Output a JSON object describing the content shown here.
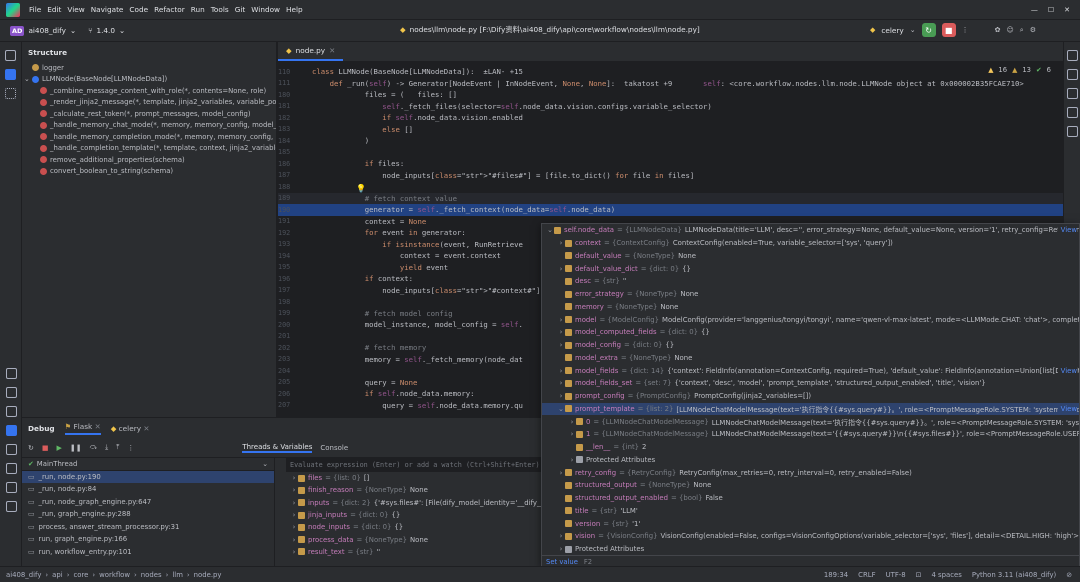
{
  "menu": [
    "File",
    "Edit",
    "View",
    "Navigate",
    "Code",
    "Refactor",
    "Run",
    "Tools",
    "Git",
    "Window",
    "Help"
  ],
  "project": {
    "badge": "AD",
    "name": "ai408_dify",
    "version": "1.4.0"
  },
  "path_title": "nodes\\llm\\node.py [F:\\Dify资料\\ai408_dify\\api\\core\\workflow\\nodes\\llm\\node.py]",
  "run_config": "celery",
  "structure": {
    "title": "Structure",
    "items": [
      {
        "text": "logger",
        "color": "#c59a4a"
      },
      {
        "text": "LLMNode(BaseNode[LLMNodeData])",
        "color": "#3574f0"
      },
      {
        "text": "_combine_message_content_with_role(*, contents=None, role)",
        "color": "#c94f4f"
      },
      {
        "text": "_render_jinja2_message(*, template, jinja2_variables, variable_pool)",
        "color": "#c94f4f"
      },
      {
        "text": "_calculate_rest_token(*, prompt_messages, model_config)",
        "color": "#c94f4f"
      },
      {
        "text": "_handle_memory_chat_mode(*, memory, memory_config, model_config)",
        "color": "#c94f4f"
      },
      {
        "text": "_handle_memory_completion_mode(*, memory, memory_config, model_config)",
        "color": "#c94f4f"
      },
      {
        "text": "_handle_completion_template(*, template, context, jinja2_variables, variable_pool)",
        "color": "#c94f4f"
      },
      {
        "text": "remove_additional_properties(schema)",
        "color": "#c94f4f"
      },
      {
        "text": "convert_boolean_to_string(schema)",
        "color": "#c94f4f"
      }
    ]
  },
  "editor_tab": "node.py",
  "code_lines": [
    {
      "n": "110",
      "t": "class LLMNode(BaseNode[LLMNodeData]):  ±LAN- +15"
    },
    {
      "n": "111",
      "t": "    def _run(self) -> Generator[NodeEvent | InNodeEvent, None, None]:  takatost +9       self: <core.workflow.nodes.llm.node.LLMNode object at 0x000002B35FCAE710>"
    },
    {
      "n": "180",
      "t": "            files = (   files: []"
    },
    {
      "n": "181",
      "t": "                self._fetch_files(selector=self.node_data.vision.configs.variable_selector)"
    },
    {
      "n": "182",
      "t": "                if self.node_data.vision.enabled"
    },
    {
      "n": "183",
      "t": "                else []"
    },
    {
      "n": "184",
      "t": "            )"
    },
    {
      "n": "185",
      "t": ""
    },
    {
      "n": "186",
      "t": "            if files:"
    },
    {
      "n": "187",
      "t": "                node_inputs[\"#files#\"] = [file.to_dict() for file in files]"
    },
    {
      "n": "188",
      "t": ""
    },
    {
      "n": "189",
      "t": "            # fetch context value"
    },
    {
      "n": "190",
      "t": "            generator = self._fetch_context(node_data=self.node_data)"
    },
    {
      "n": "191",
      "t": "            context = None"
    },
    {
      "n": "192",
      "t": "            for event in generator:"
    },
    {
      "n": "193",
      "t": "                if isinstance(event, RunRetrieve"
    },
    {
      "n": "194",
      "t": "                    context = event.context"
    },
    {
      "n": "195",
      "t": "                    yield event"
    },
    {
      "n": "196",
      "t": "            if context:"
    },
    {
      "n": "197",
      "t": "                node_inputs[\"#context#\"] = conte"
    },
    {
      "n": "198",
      "t": ""
    },
    {
      "n": "199",
      "t": "            # fetch model config"
    },
    {
      "n": "200",
      "t": "            model_instance, model_config = self."
    },
    {
      "n": "201",
      "t": ""
    },
    {
      "n": "202",
      "t": "            # fetch memory"
    },
    {
      "n": "203",
      "t": "            memory = self._fetch_memory(node_dat"
    },
    {
      "n": "204",
      "t": ""
    },
    {
      "n": "205",
      "t": "            query = None"
    },
    {
      "n": "206",
      "t": "            if self.node_data.memory:"
    },
    {
      "n": "207",
      "t": "                query = self.node_data.memory.qu"
    }
  ],
  "inspections": {
    "warnings": "16",
    "weak": "13",
    "ok": "6"
  },
  "debug": {
    "title": "Debug",
    "tabs": [
      "Flask",
      "celery"
    ],
    "subtabs": [
      "Threads & Variables",
      "Console"
    ],
    "thread": "MainThread",
    "eval_placeholder": "Evaluate expression (Enter) or add a watch (Ctrl+Shift+Enter)",
    "frames": [
      "_run, node.py:190",
      "_run, node.py:84",
      "_run, node_graph_engine.py:647",
      "_run, graph_engine.py:288",
      "process, answer_stream_processor.py:31",
      "run, graph_engine.py:166",
      "run, workflow_entry.py:101"
    ],
    "vars": [
      {
        "name": "files",
        "type": "{list: 0}",
        "val": "[]"
      },
      {
        "name": "finish_reason",
        "type": "{NoneType}",
        "val": "None"
      },
      {
        "name": "inputs",
        "type": "{dict: 2}",
        "val": "{'#sys.files#': [File(dify_model_identity='__dify__file__', id=("
      },
      {
        "name": "jinja_inputs",
        "type": "{dict: 0}",
        "val": "{}"
      },
      {
        "name": "node_inputs",
        "type": "{dict: 0}",
        "val": "{}"
      },
      {
        "name": "process_data",
        "type": "{NoneType}",
        "val": "None"
      },
      {
        "name": "result_text",
        "type": "{str}",
        "val": "''"
      }
    ]
  },
  "popup": {
    "rows": [
      {
        "d": 0,
        "tw": "⌄",
        "name": "self.node_data",
        "type": "= {LLMNodeData}",
        "val": "LLMNodeData(title='LLM', desc='', error_strategy=None, default_value=None, version='1', retry_config=RetryConfig(max_ret...",
        "sel": false,
        "view": "View"
      },
      {
        "d": 1,
        "tw": "›",
        "name": "context",
        "type": "= {ContextConfig}",
        "val": "ContextConfig(enabled=True, variable_selector=['sys', 'query'])"
      },
      {
        "d": 1,
        "tw": "",
        "name": "default_value",
        "type": "= {NoneType}",
        "val": "None"
      },
      {
        "d": 1,
        "tw": "›",
        "name": "default_value_dict",
        "type": "= {dict: 0}",
        "val": "{}"
      },
      {
        "d": 1,
        "tw": "",
        "name": "desc",
        "type": "= {str}",
        "val": "''"
      },
      {
        "d": 1,
        "tw": "",
        "name": "error_strategy",
        "type": "= {NoneType}",
        "val": "None"
      },
      {
        "d": 1,
        "tw": "",
        "name": "memory",
        "type": "= {NoneType}",
        "val": "None"
      },
      {
        "d": 1,
        "tw": "›",
        "name": "model",
        "type": "= {ModelConfig}",
        "val": "ModelConfig(provider='langgenius/tongyi/tongyi', name='qwen-vl-max-latest', mode=<LLMMode.CHAT: 'chat'>, completion_params={})"
      },
      {
        "d": 1,
        "tw": "›",
        "name": "model_computed_fields",
        "type": "= {dict: 0}",
        "val": "{}"
      },
      {
        "d": 1,
        "tw": "›",
        "name": "model_config",
        "type": "= {dict: 0}",
        "val": "{}"
      },
      {
        "d": 1,
        "tw": "",
        "name": "model_extra",
        "type": "= {NoneType}",
        "val": "None"
      },
      {
        "d": 1,
        "tw": "›",
        "name": "model_fields",
        "type": "= {dict: 14}",
        "val": "{'context': FieldInfo(annotation=ContextConfig, required=True), 'default_value': FieldInfo(annotation=Union[list[DefaultValue], None...",
        "view": "View"
      },
      {
        "d": 1,
        "tw": "›",
        "name": "model_fields_set",
        "type": "= {set: 7}",
        "val": "{'context', 'desc', 'model', 'prompt_template', 'structured_output_enabled', 'title', 'vision'}"
      },
      {
        "d": 1,
        "tw": "›",
        "name": "prompt_config",
        "type": "= {PromptConfig}",
        "val": "PromptConfig(jinja2_variables=[])"
      },
      {
        "d": 1,
        "tw": "⌄",
        "name": "prompt_template",
        "type": "= {list: 2}",
        "val": "[LLMNodeChatModelMessage(text='执行指令{{#sys.query#}}。', role=<PromptMessageRole.SYSTEM: 'system'>, edition_type=N...",
        "sel": true,
        "view": "View"
      },
      {
        "d": 2,
        "tw": "›",
        "name": "0",
        "type": "= {LLMNodeChatModelMessage}",
        "val": "LLMNodeChatModelMessage(text='执行指令{{#sys.query#}}。', role=<PromptMessageRole.SYSTEM: 'system'>, edition_typ"
      },
      {
        "d": 2,
        "tw": "›",
        "name": "1",
        "type": "= {LLMNodeChatModelMessage}",
        "val": "LLMNodeChatModelMessage(text='{{#sys.query#}}\\n{{#sys.files#}}', role=<PromptMessageRole.USER: 'user'>, edition_typ"
      },
      {
        "d": 2,
        "tw": "",
        "name": "__len__",
        "type": "= {int}",
        "val": "2"
      },
      {
        "d": 2,
        "tw": "›",
        "name": "Protected Attributes",
        "type": "",
        "val": ""
      },
      {
        "d": 1,
        "tw": "›",
        "name": "retry_config",
        "type": "= {RetryConfig}",
        "val": "RetryConfig(max_retries=0, retry_interval=0, retry_enabled=False)"
      },
      {
        "d": 1,
        "tw": "",
        "name": "structured_output",
        "type": "= {NoneType}",
        "val": "None"
      },
      {
        "d": 1,
        "tw": "",
        "name": "structured_output_enabled",
        "type": "= {bool}",
        "val": "False"
      },
      {
        "d": 1,
        "tw": "",
        "name": "title",
        "type": "= {str}",
        "val": "'LLM'"
      },
      {
        "d": 1,
        "tw": "",
        "name": "version",
        "type": "= {str}",
        "val": "'1'"
      },
      {
        "d": 1,
        "tw": "›",
        "name": "vision",
        "type": "= {VisionConfig}",
        "val": "VisionConfig(enabled=False, configs=VisionConfigOptions(variable_selector=['sys', 'files'], detail=<DETAIL.HIGH: 'high'>))"
      },
      {
        "d": 1,
        "tw": "›",
        "name": "Protected Attributes",
        "type": "",
        "val": ""
      }
    ],
    "footer_a": "Set value",
    "footer_b": "F2"
  },
  "statusbar": {
    "breadcrumb": [
      "ai408_dify",
      "api",
      "core",
      "workflow",
      "nodes",
      "llm",
      "node.py"
    ],
    "position": "189:34",
    "line_sep": "CRLF",
    "encoding": "UTF-8",
    "indent": "4 spaces",
    "interpreter": "Python 3.11 (ai408_dify)"
  }
}
